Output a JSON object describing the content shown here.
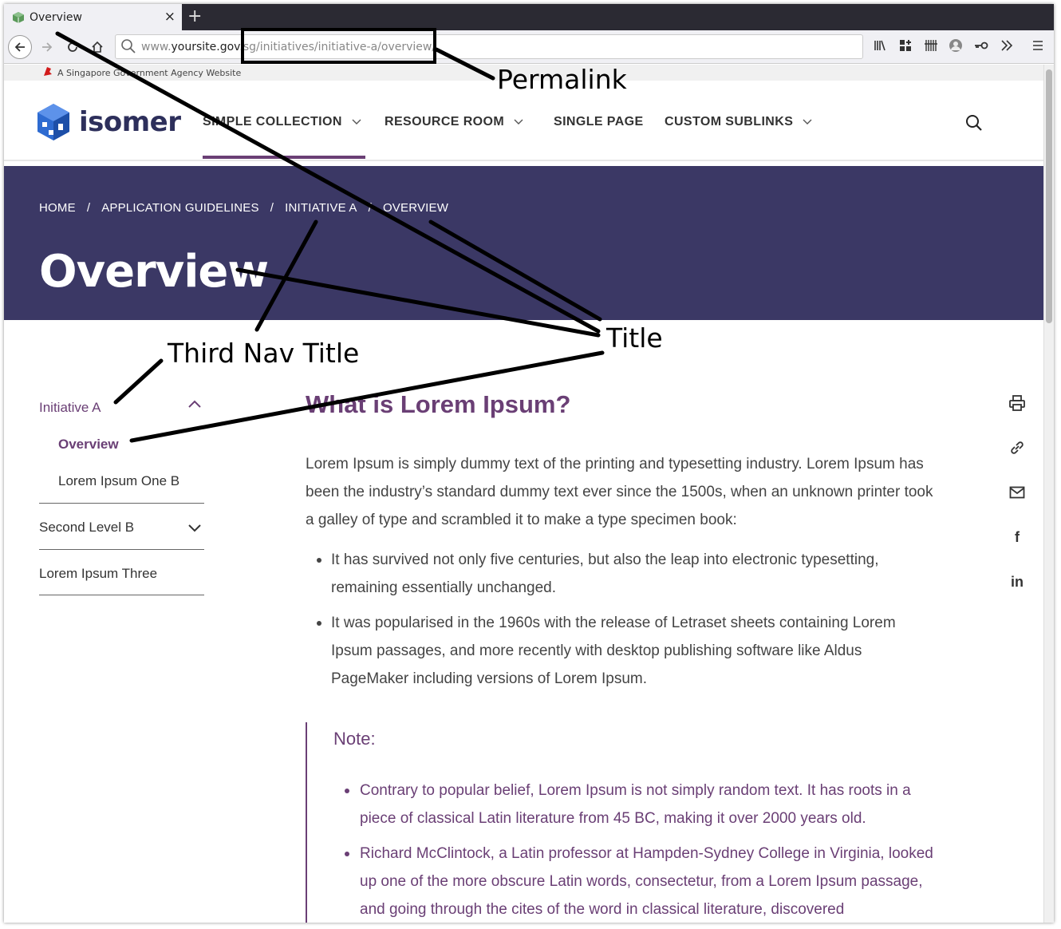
{
  "browser": {
    "tab_title": "Overview",
    "tab_close": "×",
    "new_tab": "+",
    "url_domain_prefix": "www.",
    "url_domain": "yoursite.gov.",
    "url_hidden": "sg",
    "url_path": "/initiatives/initiative-a/overview/",
    "toolbar_icons": [
      "library-icon",
      "extensions-icon",
      "barcode-icon",
      "avatar-icon",
      "key-icon",
      "overflow-icon",
      "menu-icon"
    ]
  },
  "gov_banner": {
    "text": "A Singapore Government Agency Website"
  },
  "site": {
    "logo_text": "isomer",
    "nav": [
      {
        "label": "SIMPLE COLLECTION",
        "has_dropdown": true,
        "active": true
      },
      {
        "label": "RESOURCE ROOM",
        "has_dropdown": true
      },
      {
        "label": "SINGLE PAGE",
        "has_dropdown": false
      },
      {
        "label": "CUSTOM SUBLINKS",
        "has_dropdown": true
      }
    ],
    "accent_color": "#6a3f75",
    "hero_color": "#3b3865"
  },
  "hero": {
    "breadcrumbs": [
      "HOME",
      "APPLICATION GUIDELINES",
      "INITIATIVE A",
      "OVERVIEW"
    ],
    "separator": "/",
    "title": "Overview"
  },
  "sidebar": {
    "section_title": "Initiative A",
    "section_items": [
      "Overview",
      "Lorem Ipsum One B"
    ],
    "levels": [
      "Second Level B",
      "Lorem Ipsum Three"
    ]
  },
  "content": {
    "heading": "What is Lorem Ipsum?",
    "paragraph": "Lorem Ipsum is simply dummy text of the printing and typesetting industry. Lorem Ipsum has been the industry’s standard dummy text ever since the 1500s, when an unknown printer took a galley of type and scrambled it to make a type specimen book:",
    "bullets": [
      "It has survived not only five centuries, but also the leap into electronic typesetting, remaining essentially unchanged.",
      "It was popularised in the 1960s with the release of Letraset sheets containing Lorem Ipsum passages, and more recently with desktop publishing software like Aldus PageMaker including versions of Lorem Ipsum."
    ],
    "note_title": "Note:",
    "note_bullets": [
      "Contrary to popular belief, Lorem Ipsum is not simply random text. It has roots in a piece of classical Latin literature from 45 BC, making it over 2000 years old.",
      "Richard McClintock, a Latin professor at Hampden-Sydney College in Virginia, looked up one of the more obscure Latin words, consectetur, from a Lorem Ipsum passage, and going through the cites of the word in classical literature, discovered"
    ]
  },
  "share_icons": [
    "print-icon",
    "link-icon",
    "mail-icon",
    "facebook-icon",
    "linkedin-icon"
  ],
  "share_text": {
    "facebook": "f",
    "linkedin": "in"
  },
  "annotations": {
    "permalink": "Permalink",
    "title": "Title",
    "third_nav_title": "Third Nav Title"
  }
}
